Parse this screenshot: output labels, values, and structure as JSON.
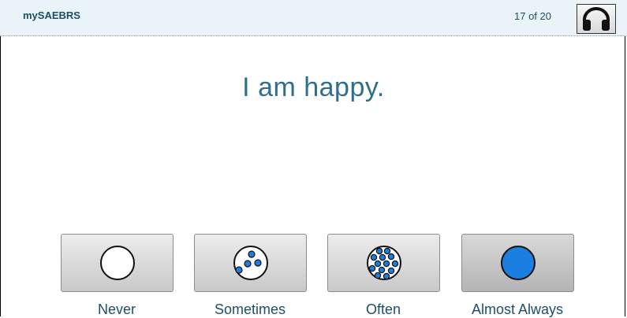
{
  "app": {
    "name": "mySAEBRS"
  },
  "header": {
    "progress": "17 of 20",
    "audio_icon": "headphones-icon"
  },
  "question": {
    "text": "I am happy."
  },
  "answers": [
    {
      "label": "Never",
      "icon": "empty-circle-icon"
    },
    {
      "label": "Sometimes",
      "icon": "few-dots-circle-icon"
    },
    {
      "label": "Often",
      "icon": "many-dots-circle-icon"
    },
    {
      "label": "Almost Always",
      "icon": "filled-circle-icon"
    }
  ],
  "colors": {
    "accent_blue": "#1a7fe0",
    "text_teal": "#2f6f8c",
    "header_bg": "#e9f3f8"
  }
}
